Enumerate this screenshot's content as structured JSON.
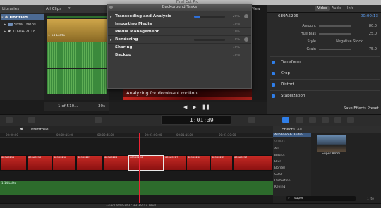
{
  "app": {
    "title": "Final Cut Pro"
  },
  "libraries": {
    "header": "Libraries",
    "items": [
      {
        "label": "Untitled",
        "selected": true,
        "indent": 0
      },
      {
        "label": "Sma...tions",
        "indent": 1
      },
      {
        "label": "10-04-2018",
        "indent": 1
      }
    ]
  },
  "browser": {
    "filter": "All Clips",
    "clip_name": "1-14 Lolita",
    "counter": "1 of 510...",
    "duration": "30s"
  },
  "viewer": {
    "menu": "View",
    "analyzing_text": "Analyzing for dominant motion...",
    "timecode": "1:01:39"
  },
  "background_tasks": {
    "title": "Background Tasks",
    "tasks": [
      {
        "label": "Transcoding and Analysis",
        "percent": "20%",
        "progress": 0.2
      },
      {
        "label": "Importing Media",
        "percent": "10%"
      },
      {
        "label": "Media Management",
        "percent": "10%"
      },
      {
        "label": "Rendering",
        "percent": "0%",
        "progress": 0
      },
      {
        "label": "Sharing",
        "percent": "10%"
      },
      {
        "label": "Backup",
        "percent": "10%"
      }
    ]
  },
  "inspector": {
    "tabs": [
      "Video",
      "Audio",
      "Info"
    ],
    "clip_id": "689A5226",
    "clip_tc": "00:00:13",
    "params": [
      {
        "label": "Amount",
        "value": "80.0"
      },
      {
        "label": "Hue Bias",
        "value": "25.0"
      },
      {
        "label": "Style",
        "value": "Negative Stock"
      },
      {
        "label": "Grain",
        "value": "75.0"
      }
    ],
    "sections": [
      "Transform",
      "Crop",
      "Distort",
      "Stabilization"
    ],
    "save_button": "Save Effects Preset"
  },
  "timeline": {
    "project": "Primrose",
    "ruler": [
      "00:00:00",
      "00:00:15:00",
      "00:00:45:00",
      "00:01:00:00",
      "00:01:15:00",
      "00:01:30:00"
    ],
    "clips": [
      "689A5211",
      "689A5212",
      "689A5218",
      "689A5221",
      "689A5224",
      "689A5226",
      "689A5227",
      "689A5230",
      "689A5235",
      "689A5237"
    ],
    "audio_name": "1-14 Lolita"
  },
  "effects": {
    "header": "Effects",
    "scope": "All",
    "category_header": "VIDEO",
    "categories": [
      "All Video & Audio",
      "All",
      "Basics",
      "Blur",
      "Border",
      "Color",
      "Distortion",
      "Keying"
    ],
    "selected_category": "All Video & Audio",
    "result_name": "Super 8mm",
    "search_value": "super",
    "count": "1 ite"
  },
  "status": {
    "text": "13:10 selected - 15:10:47 total"
  },
  "colors": {
    "accent": "#2f7ee8",
    "clip": "#c62a25",
    "audio": "#2d6b2c",
    "playhead": "#e23"
  }
}
